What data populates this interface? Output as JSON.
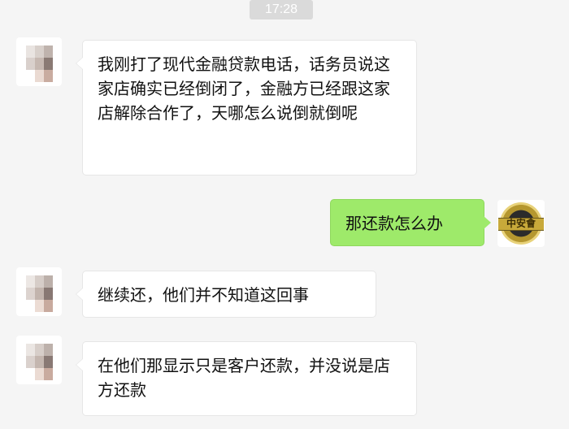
{
  "chat": {
    "timestamp": "17:28",
    "messages": [
      {
        "side": "left",
        "text": "我刚打了现代金融贷款电话，话务员说这家店确实已经倒闭了，金融方已经跟这家店解除合作了，天哪怎么说倒就倒呢"
      },
      {
        "side": "right",
        "text": "那还款怎么办"
      },
      {
        "side": "left",
        "text": "继续还，他们并不知道这回事"
      },
      {
        "side": "left",
        "text": "在他们那显示只是客户还款，并没说是店方还款"
      }
    ]
  },
  "self_avatar": {
    "badge_text": "中安會"
  },
  "colors": {
    "background": "#f5f5f5",
    "bubble_left": "#ffffff",
    "bubble_right": "#9eea6a",
    "timestamp_bg": "#dadada"
  },
  "icons": {
    "contact_avatar": "pixelated-avatar-icon",
    "self_avatar": "badge-logo-icon"
  }
}
